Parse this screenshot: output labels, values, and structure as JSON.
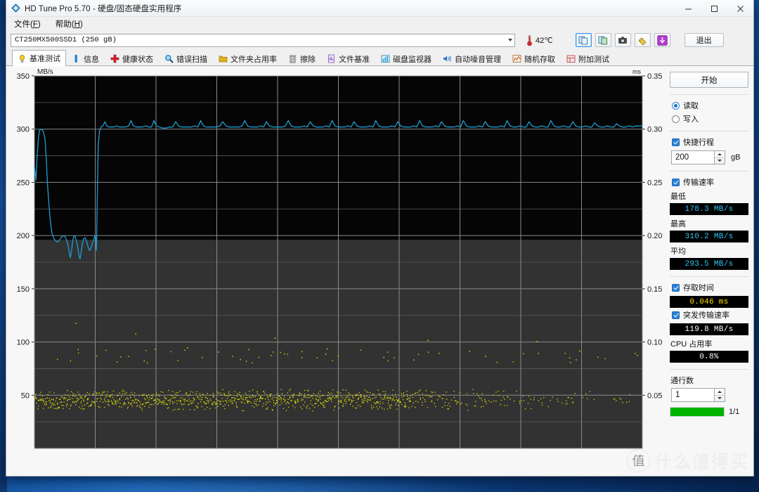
{
  "window": {
    "title": "HD Tune Pro 5.70 - 硬盘/固态硬盘实用程序",
    "app_icon": "diamond-icon",
    "minimize": "—",
    "maximize": "□",
    "close": "✕"
  },
  "menu": [
    {
      "label": "文件",
      "accel": "F"
    },
    {
      "label": "帮助",
      "accel": "H"
    }
  ],
  "drive": {
    "selected": "CT250MX500SSD1  (250  gB)",
    "temperature": "42℃",
    "thermometer_icon": "thermometer-icon",
    "tools": [
      {
        "name": "copy-icon",
        "glyph": "❐",
        "selected": true
      },
      {
        "name": "copy-image-icon",
        "glyph": "❐",
        "selected": false
      },
      {
        "name": "camera-icon",
        "glyph": "▣",
        "selected": false
      },
      {
        "name": "tag-icon",
        "glyph": "✎",
        "selected": false
      },
      {
        "name": "download-icon",
        "glyph": "↓",
        "selected": false
      }
    ],
    "exit_label": "退出"
  },
  "tabs": [
    {
      "label": "基准测试",
      "icon": "lightbulb-icon",
      "color": "#f2c41a",
      "active": true
    },
    {
      "label": "信息",
      "icon": "info-icon",
      "color": "#1f7fd4",
      "active": false
    },
    {
      "label": "健康状态",
      "icon": "cross-icon",
      "color": "#d61f26",
      "active": false
    },
    {
      "label": "错误扫描",
      "icon": "magnifier-icon",
      "color": "#1f9ad6",
      "active": false
    },
    {
      "label": "文件夹占用率",
      "icon": "folder-icon",
      "color": "#e3b018",
      "active": false
    },
    {
      "label": "擦除",
      "icon": "trash-icon",
      "color": "#8d949b",
      "active": false
    },
    {
      "label": "文件基准",
      "icon": "file-benchmark-icon",
      "color": "#9d5fd4",
      "active": false
    },
    {
      "label": "磁盘监视器",
      "icon": "chart-bars-icon",
      "color": "#2fa8d8",
      "active": false
    },
    {
      "label": "自动噪音管理",
      "icon": "speaker-icon",
      "color": "#2a79c8",
      "active": false
    },
    {
      "label": "随机存取",
      "icon": "random-access-icon",
      "color": "#d26a30",
      "active": false
    },
    {
      "label": "附加测试",
      "icon": "extra-tests-icon",
      "color": "#d43f3f",
      "active": false
    }
  ],
  "panel": {
    "start_label": "开始",
    "mode_read": "读取",
    "mode_write": "写入",
    "mode_selected": "读取",
    "quick_scan_label": "快捷行程",
    "quick_scan_checked": true,
    "quick_scan_value": "200",
    "quick_scan_unit": "gB",
    "transfer_rate_label": "传输速率",
    "transfer_rate_checked": true,
    "min_label": "最低",
    "min_value": "178.3 MB/s",
    "max_label": "最高",
    "max_value": "310.2 MB/s",
    "avg_label": "平均",
    "avg_value": "293.5 MB/s",
    "access_time_label": "存取时间",
    "access_time_checked": true,
    "access_time_value": "0.046 ms",
    "burst_rate_label": "突发传输速率",
    "burst_rate_checked": true,
    "burst_rate_value": "119.8 MB/s",
    "cpu_label": "CPU 占用率",
    "cpu_value": "0.8%",
    "passes_label": "通行数",
    "passes_value": "1",
    "progress_label": "1/1",
    "progress_color": "#00b400"
  },
  "watermark": {
    "badge": "值",
    "text": "什么值得买"
  },
  "chart_data": {
    "type": "line",
    "title": "",
    "ylabel": "MB/s",
    "y2label": "ms",
    "ylim": [
      0,
      350
    ],
    "y2lim": [
      0,
      0.35
    ],
    "yticks": [
      350,
      300,
      250,
      200,
      150,
      100,
      50
    ],
    "y2ticks": [
      "0.35",
      "0.30",
      "0.25",
      "0.20",
      "0.15",
      "0.10",
      "0.05"
    ],
    "grid": true,
    "xlim": [
      0,
      200
    ],
    "legend": "none",
    "background": "#151515",
    "gridcolor": "#6e6e6e",
    "series": [
      {
        "name": "transfer-rate",
        "unit": "MB/s",
        "axis": "left",
        "color": "#1a9fd4",
        "points": [
          [
            0.0,
            265
          ],
          [
            0.5,
            252
          ],
          [
            0.9,
            275
          ],
          [
            1.3,
            292
          ],
          [
            1.7,
            299
          ],
          [
            2.2,
            300
          ],
          [
            2.7,
            299
          ],
          [
            3.1,
            296
          ],
          [
            3.5,
            290
          ],
          [
            3.9,
            272
          ],
          [
            4.3,
            248
          ],
          [
            4.8,
            228
          ],
          [
            5.3,
            212
          ],
          [
            5.8,
            202
          ],
          [
            6.4,
            197
          ],
          [
            7.0,
            195
          ],
          [
            7.6,
            194
          ],
          [
            8.3,
            196
          ],
          [
            9.0,
            199
          ],
          [
            9.7,
            200
          ],
          [
            10.3,
            198
          ],
          [
            10.9,
            193
          ],
          [
            11.4,
            185
          ],
          [
            11.8,
            179
          ],
          [
            12.2,
            186
          ],
          [
            12.6,
            195
          ],
          [
            13.0,
            200
          ],
          [
            13.4,
            199
          ],
          [
            13.8,
            195
          ],
          [
            14.2,
            190
          ],
          [
            14.6,
            182
          ],
          [
            15.0,
            178
          ],
          [
            15.4,
            185
          ],
          [
            15.8,
            193
          ],
          [
            16.2,
            197
          ],
          [
            16.6,
            198
          ],
          [
            17.0,
            196
          ],
          [
            17.4,
            192
          ],
          [
            17.8,
            188
          ],
          [
            18.2,
            186
          ],
          [
            18.6,
            188
          ],
          [
            19.0,
            192
          ],
          [
            19.4,
            196
          ],
          [
            19.8,
            199
          ],
          [
            20.1,
            200
          ],
          [
            20.4,
            186
          ],
          [
            20.7,
            240
          ],
          [
            21.0,
            285
          ],
          [
            21.4,
            298
          ],
          [
            21.9,
            302
          ],
          [
            22.5,
            303
          ],
          [
            23.2,
            307
          ],
          [
            23.8,
            303
          ],
          [
            24.5,
            302
          ],
          [
            25.3,
            302
          ],
          [
            26.1,
            302
          ],
          [
            27.0,
            303
          ],
          [
            28.0,
            302
          ],
          [
            29.0,
            302
          ],
          [
            30.0,
            302
          ],
          [
            31.0,
            303
          ],
          [
            31.8,
            308
          ],
          [
            32.5,
            303
          ],
          [
            33.4,
            302
          ],
          [
            34.4,
            302
          ],
          [
            35.5,
            302
          ],
          [
            36.6,
            303
          ],
          [
            37.6,
            302
          ],
          [
            38.5,
            302
          ],
          [
            39.3,
            308
          ],
          [
            40.1,
            303
          ],
          [
            41.1,
            302
          ],
          [
            42.2,
            301
          ],
          [
            43.3,
            301
          ],
          [
            44.4,
            302
          ],
          [
            45.5,
            302
          ],
          [
            46.5,
            307
          ],
          [
            47.4,
            303
          ],
          [
            48.4,
            302
          ],
          [
            49.5,
            302
          ],
          [
            50.6,
            302
          ],
          [
            51.7,
            302
          ],
          [
            52.8,
            303
          ],
          [
            53.8,
            302
          ],
          [
            54.7,
            308
          ],
          [
            55.6,
            303
          ],
          [
            56.6,
            302
          ],
          [
            57.7,
            302
          ],
          [
            58.8,
            302
          ],
          [
            59.9,
            302
          ],
          [
            61.0,
            303
          ],
          [
            62.0,
            307
          ],
          [
            63.0,
            303
          ],
          [
            64.0,
            302
          ],
          [
            65.1,
            302
          ],
          [
            66.2,
            302
          ],
          [
            67.3,
            302
          ],
          [
            68.3,
            303
          ],
          [
            69.2,
            308
          ],
          [
            70.1,
            303
          ],
          [
            71.1,
            302
          ],
          [
            72.2,
            302
          ],
          [
            73.3,
            302
          ],
          [
            74.4,
            303
          ],
          [
            75.4,
            302
          ],
          [
            76.3,
            307
          ],
          [
            77.3,
            303
          ],
          [
            78.3,
            302
          ],
          [
            79.4,
            302
          ],
          [
            80.5,
            302
          ],
          [
            81.6,
            302
          ],
          [
            82.6,
            303
          ],
          [
            83.5,
            308
          ],
          [
            84.5,
            303
          ],
          [
            85.5,
            302
          ],
          [
            86.6,
            302
          ],
          [
            87.7,
            302
          ],
          [
            88.8,
            303
          ],
          [
            89.8,
            302
          ],
          [
            90.7,
            307
          ],
          [
            91.7,
            303
          ],
          [
            92.7,
            302
          ],
          [
            93.8,
            302
          ],
          [
            94.9,
            302
          ],
          [
            96.0,
            303
          ],
          [
            97.0,
            302
          ],
          [
            97.9,
            308
          ],
          [
            98.9,
            303
          ],
          [
            99.9,
            302
          ],
          [
            101.0,
            302
          ],
          [
            102.1,
            302
          ],
          [
            103.2,
            303
          ],
          [
            104.2,
            302
          ],
          [
            105.1,
            307
          ],
          [
            106.1,
            303
          ],
          [
            107.1,
            302
          ],
          [
            108.2,
            302
          ],
          [
            109.3,
            302
          ],
          [
            110.4,
            303
          ],
          [
            111.4,
            302
          ],
          [
            112.3,
            308
          ],
          [
            113.3,
            303
          ],
          [
            114.3,
            302
          ],
          [
            115.4,
            302
          ],
          [
            116.5,
            302
          ],
          [
            117.6,
            303
          ],
          [
            118.6,
            302
          ],
          [
            119.5,
            307
          ],
          [
            120.5,
            303
          ],
          [
            121.5,
            302
          ],
          [
            122.6,
            302
          ],
          [
            123.7,
            302
          ],
          [
            124.8,
            303
          ],
          [
            125.8,
            302
          ],
          [
            126.7,
            308
          ],
          [
            127.7,
            303
          ],
          [
            128.7,
            302
          ],
          [
            129.8,
            302
          ],
          [
            130.9,
            302
          ],
          [
            132.0,
            303
          ],
          [
            133.0,
            302
          ],
          [
            133.9,
            307
          ],
          [
            134.9,
            303
          ],
          [
            135.9,
            302
          ],
          [
            137.0,
            302
          ],
          [
            138.1,
            302
          ],
          [
            139.2,
            303
          ],
          [
            140.2,
            302
          ],
          [
            141.1,
            308
          ],
          [
            142.1,
            303
          ],
          [
            143.1,
            302
          ],
          [
            144.2,
            302
          ],
          [
            145.3,
            302
          ],
          [
            146.4,
            303
          ],
          [
            147.4,
            302
          ],
          [
            148.3,
            307
          ],
          [
            149.3,
            303
          ],
          [
            150.3,
            302
          ],
          [
            151.4,
            302
          ],
          [
            152.5,
            302
          ],
          [
            153.6,
            303
          ],
          [
            154.6,
            302
          ],
          [
            155.5,
            308
          ],
          [
            156.5,
            303
          ],
          [
            157.5,
            302
          ],
          [
            158.6,
            302
          ],
          [
            159.7,
            303
          ],
          [
            160.8,
            302
          ],
          [
            161.8,
            302
          ],
          [
            162.7,
            307
          ],
          [
            163.7,
            303
          ],
          [
            164.7,
            302
          ],
          [
            165.8,
            302
          ],
          [
            166.9,
            303
          ],
          [
            168.0,
            302
          ],
          [
            169.0,
            302
          ],
          [
            169.9,
            308
          ],
          [
            170.9,
            303
          ],
          [
            171.9,
            302
          ],
          [
            173.0,
            302
          ],
          [
            174.1,
            303
          ],
          [
            175.2,
            302
          ],
          [
            176.2,
            302
          ],
          [
            177.1,
            307
          ],
          [
            178.1,
            303
          ],
          [
            179.1,
            302
          ],
          [
            180.2,
            302
          ],
          [
            181.3,
            303
          ],
          [
            182.4,
            302
          ],
          [
            183.4,
            302
          ],
          [
            184.3,
            306
          ],
          [
            185.3,
            303
          ],
          [
            186.3,
            302
          ],
          [
            187.4,
            302
          ],
          [
            188.5,
            303
          ],
          [
            189.6,
            302
          ],
          [
            190.6,
            302
          ],
          [
            191.5,
            305
          ],
          [
            192.5,
            303
          ],
          [
            193.5,
            302
          ],
          [
            194.6,
            302
          ],
          [
            195.7,
            303
          ],
          [
            196.8,
            302
          ],
          [
            197.8,
            303
          ],
          [
            199.0,
            303
          ],
          [
            200.0,
            303
          ]
        ]
      },
      {
        "name": "access-time",
        "unit": "ms",
        "axis": "right",
        "color": "#e0e000",
        "marker": "dot",
        "mean_ms": 0.046,
        "outliers_ms": [
          0.118,
          0.108,
          0.095,
          0.091,
          0.104,
          0.089,
          0.086,
          0.102,
          0.087,
          0.101,
          0.092
        ],
        "cluster_band_ms": [
          0.04,
          0.052
        ]
      }
    ]
  }
}
